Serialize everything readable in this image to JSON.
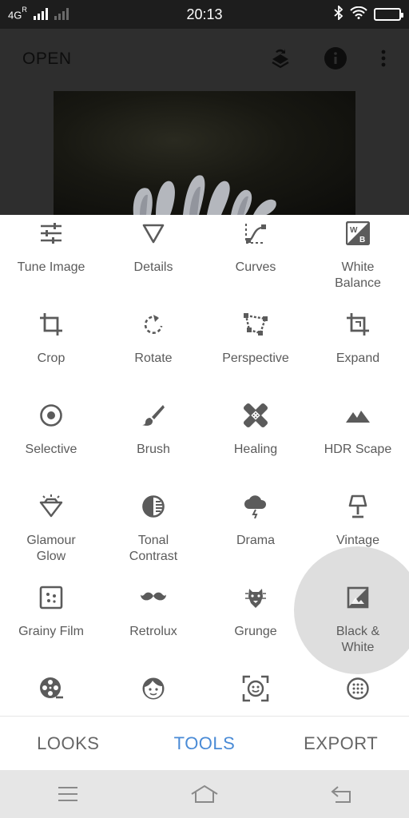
{
  "status_bar": {
    "network": "4G",
    "network_sup": "R",
    "time": "20:13",
    "battery_level_pct": 100
  },
  "app_bar": {
    "open_label": "OPEN",
    "icons": [
      "layers-icon",
      "info-icon",
      "more-vert-icon"
    ]
  },
  "tools": [
    {
      "label": "Tune Image",
      "icon": "tune-sliders-icon"
    },
    {
      "label": "Details",
      "icon": "triangle-icon"
    },
    {
      "label": "Curves",
      "icon": "curves-icon"
    },
    {
      "label": "White\nBalance",
      "icon": "white-balance-icon"
    },
    {
      "label": "Crop",
      "icon": "crop-icon"
    },
    {
      "label": "Rotate",
      "icon": "rotate-icon"
    },
    {
      "label": "Perspective",
      "icon": "perspective-icon"
    },
    {
      "label": "Expand",
      "icon": "expand-icon"
    },
    {
      "label": "Selective",
      "icon": "selective-icon"
    },
    {
      "label": "Brush",
      "icon": "brush-icon"
    },
    {
      "label": "Healing",
      "icon": "bandage-icon"
    },
    {
      "label": "HDR Scape",
      "icon": "mountains-icon"
    },
    {
      "label": "Glamour\nGlow",
      "icon": "diamond-icon"
    },
    {
      "label": "Tonal\nContrast",
      "icon": "tonal-contrast-icon"
    },
    {
      "label": "Drama",
      "icon": "cloud-storm-icon"
    },
    {
      "label": "Vintage",
      "icon": "lamp-icon"
    },
    {
      "label": "Grainy Film",
      "icon": "grain-icon"
    },
    {
      "label": "Retrolux",
      "icon": "mustache-icon"
    },
    {
      "label": "Grunge",
      "icon": "grunge-icon"
    },
    {
      "label": "Black &\nWhite",
      "icon": "black-white-icon"
    },
    {
      "label": "",
      "icon": "film-reel-icon"
    },
    {
      "label": "",
      "icon": "face-icon"
    },
    {
      "label": "",
      "icon": "face-detect-icon"
    },
    {
      "label": "",
      "icon": "dots-circle-icon"
    }
  ],
  "tabs": [
    {
      "label": "LOOKS",
      "active": false
    },
    {
      "label": "TOOLS",
      "active": true
    },
    {
      "label": "EXPORT",
      "active": false
    }
  ],
  "nav_bar": {
    "icons": [
      "menu-icon",
      "home-icon",
      "back-icon"
    ]
  },
  "colors": {
    "accent": "#4a8bd6",
    "icon": "#5b5b5b",
    "ripple": "#dedede"
  }
}
